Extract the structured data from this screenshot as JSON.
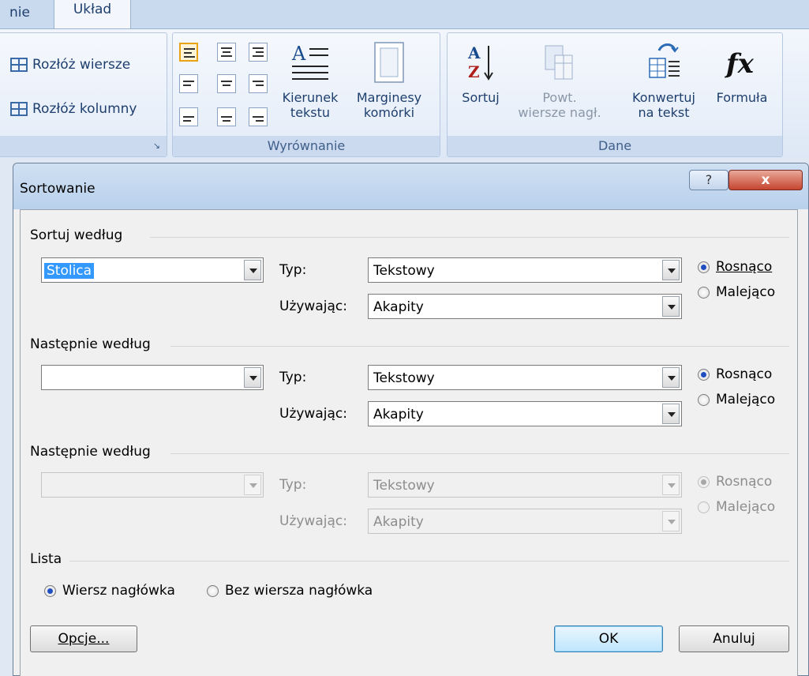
{
  "ribbon": {
    "tabs": [
      "nie",
      "Układ"
    ],
    "groups": {
      "rows": {
        "distribute_rows": "Rozłóż wiersze",
        "distribute_columns": "Rozłóż kolumny"
      },
      "align": {
        "label": "Wyrównanie",
        "text_direction": [
          "Kierunek",
          "tekstu"
        ],
        "cell_margins": [
          "Marginesy",
          "komórki"
        ]
      },
      "data": {
        "label": "Dane",
        "sort": "Sortuj",
        "repeat_header": [
          "Powt.",
          "wiersze nagł."
        ],
        "convert": [
          "Konwertuj",
          "na tekst"
        ],
        "formula": "Formuła"
      }
    }
  },
  "dialog": {
    "title": "Sortowanie",
    "help": "?",
    "close": "x",
    "sort_by": {
      "label": "Sortuj według",
      "field": "Stolica",
      "type_label": "Typ:",
      "type_value": "Tekstowy",
      "using_label": "Używając:",
      "using_value": "Akapity",
      "asc": "Rosnąco",
      "desc": "Malejąco",
      "selected": "asc"
    },
    "then_by_1": {
      "label": "Następnie według",
      "field": "",
      "type_label": "Typ:",
      "type_value": "Tekstowy",
      "using_label": "Używając:",
      "using_value": "Akapity",
      "asc": "Rosnąco",
      "desc": "Malejąco",
      "selected": "asc"
    },
    "then_by_2": {
      "label": "Następnie według",
      "field": "",
      "type_label": "Typ:",
      "type_value": "Tekstowy",
      "using_label": "Używając:",
      "using_value": "Akapity",
      "asc": "Rosnąco",
      "desc": "Malejąco",
      "selected": "asc",
      "disabled": true
    },
    "list": {
      "label": "Lista",
      "header_row": "Wiersz nagłówka",
      "no_header_row": "Bez wiersza nagłówka",
      "selected": "header_row"
    },
    "buttons": {
      "options": "Opcje...",
      "ok": "OK",
      "cancel": "Anuluj"
    }
  }
}
